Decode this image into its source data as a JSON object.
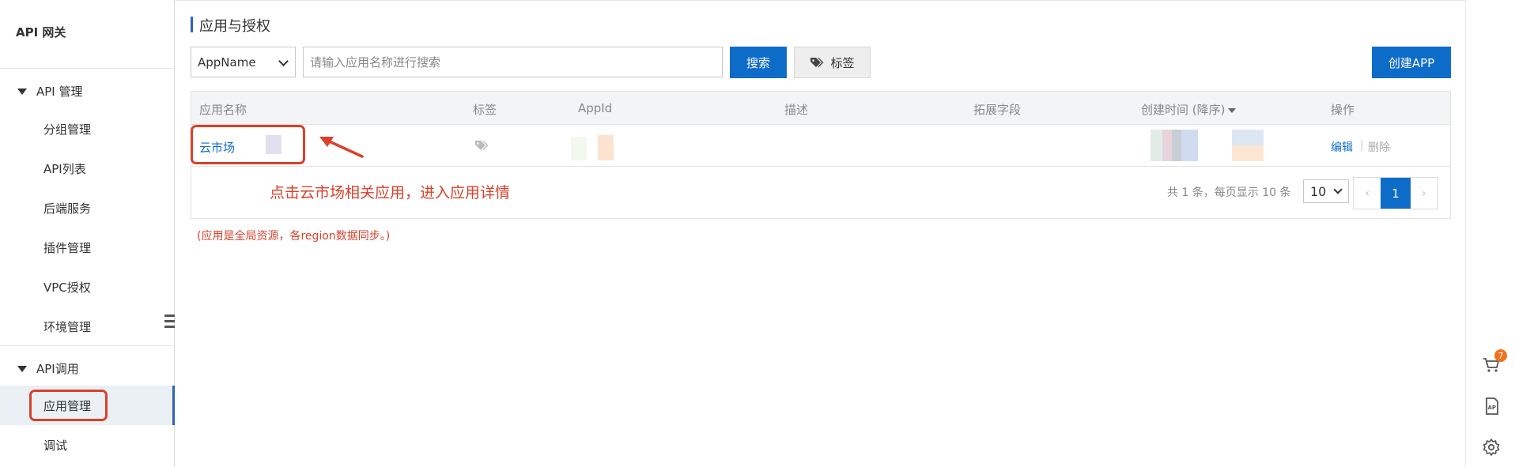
{
  "sidebar": {
    "brand": "API 网关",
    "groups": [
      {
        "label": "API 管理",
        "items": [
          "分组管理",
          "API列表",
          "后端服务",
          "插件管理",
          "VPC授权",
          "环境管理"
        ]
      },
      {
        "label": "API调用",
        "items": [
          "应用管理",
          "调试"
        ]
      }
    ],
    "active_item": "应用管理"
  },
  "page": {
    "title": "应用与授权"
  },
  "filter": {
    "field_selected": "AppName",
    "search_placeholder": "请输入应用名称进行搜索",
    "search_button": "搜索",
    "tag_button": "标签",
    "create_button": "创建APP"
  },
  "table": {
    "columns": [
      "应用名称",
      "标签",
      "AppId",
      "描述",
      "拓展字段",
      "创建时间 (降序)",
      "操作"
    ],
    "rows": [
      {
        "name": "云市场",
        "actions": {
          "edit": "编辑",
          "separator": "|",
          "delete": "删除"
        }
      }
    ]
  },
  "annotation": {
    "callout": "点击云市场相关应用，进入应用详情",
    "note": "(应用是全局资源，各region数据同步。)"
  },
  "pagination": {
    "total_text": "共 1 条，每页显示 10 条",
    "page_size": "10",
    "current_page": "1",
    "prev": "‹",
    "next": "›"
  },
  "right_toolbar": {
    "cart_badge": "7"
  },
  "colors": {
    "primary": "#0e6cc9",
    "annotation_red": "#d9412b",
    "active_nav_bg": "#ebf0f5"
  }
}
